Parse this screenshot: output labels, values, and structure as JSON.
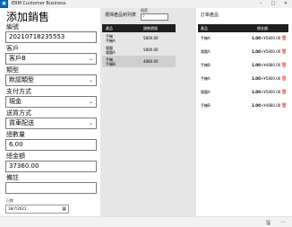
{
  "window": {
    "icon_glyph": "▣",
    "title": "ERM Customer Business",
    "minimize": "–",
    "maximize": "□",
    "close": "✕"
  },
  "form": {
    "title": "添加銷售",
    "id_label": "編號",
    "id_value": "20210718235553",
    "customer_label": "客戶",
    "customer_value": "客戶B",
    "type_label": "類型",
    "type_value": "默認類型",
    "payment_label": "支付方式",
    "payment_value": "現金",
    "shipping_label": "送貨方式",
    "shipping_value": "貨車配送",
    "total_qty_label": "總數量",
    "total_qty_value": "6.00",
    "total_amount_label": "總金額",
    "total_amount_value": "37360.00",
    "notes_label": "備註",
    "notes_value": "",
    "date_label": "日期",
    "date_value": "18/7/2021"
  },
  "product_list": {
    "title": "選擇產品到列表",
    "search_label": "搜索",
    "search_icon": "search-icon",
    "columns": [
      "產品",
      "銷售價格"
    ],
    "rows": [
      {
        "name_line1": "手機",
        "name_line2": "手機A",
        "price": "5800.00",
        "selected": false
      },
      {
        "name_line1": "電腦",
        "name_line2": "電腦A",
        "price": "5800.00",
        "selected": false
      },
      {
        "name_line1": "手機",
        "name_line2": "手機B",
        "price": "4880.00",
        "selected": true
      }
    ]
  },
  "order_list": {
    "title": "訂單產品",
    "columns": [
      "產品",
      "總金額"
    ],
    "delete_icon": "trash-icon",
    "rows": [
      {
        "name": "手機A",
        "qty": "1.00",
        "amount": "¥5800.00"
      },
      {
        "name": "電腦A",
        "qty": "1.00",
        "amount": "¥5800.00"
      },
      {
        "name": "手機B",
        "qty": "1.00",
        "amount": "¥4880.00"
      },
      {
        "name": "手機A",
        "qty": "1.00",
        "amount": "¥5800.00"
      },
      {
        "name": "電腦A",
        "qty": "1.00",
        "amount": "¥5800.00"
      },
      {
        "name": "手機B",
        "qty": "1.00",
        "amount": "¥4880.00"
      }
    ]
  },
  "bottom_bar": {
    "save_icon": "save-icon",
    "more_icon": "more-icon"
  },
  "colors": {
    "header_dark": "#1f1f1f",
    "delete_red": "#e53935",
    "mid_pane_bg": "#e6e6e6",
    "accent": "#0063b1"
  }
}
